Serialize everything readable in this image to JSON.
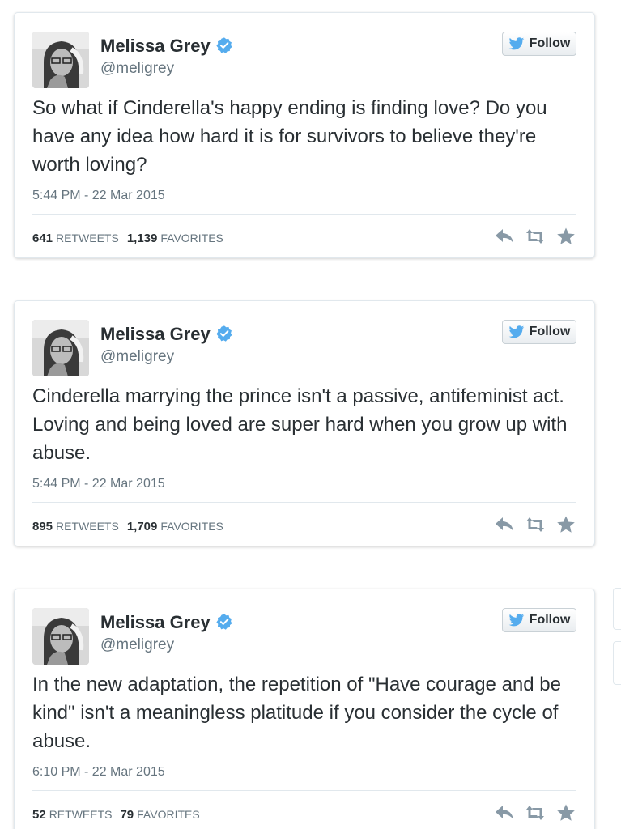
{
  "tweets": [
    {
      "name": "Melissa Grey",
      "handle": "@meligrey",
      "follow_label": "Follow",
      "text": "So what if Cinderella's happy ending is finding love? Do you have any idea how hard it is for survivors to believe they're worth loving?",
      "timestamp": "5:44 PM - 22 Mar 2015",
      "retweets": "641",
      "retweets_label": "RETWEETS",
      "favorites": "1,139",
      "favorites_label": "FAVORITES"
    },
    {
      "name": "Melissa Grey",
      "handle": "@meligrey",
      "follow_label": "Follow",
      "text": "Cinderella marrying the prince isn't a passive, antifeminist act. Loving and being loved are super hard when you grow up with abuse.",
      "timestamp": "5:44 PM - 22 Mar 2015",
      "retweets": "895",
      "retweets_label": "RETWEETS",
      "favorites": "1,709",
      "favorites_label": "FAVORITES"
    },
    {
      "name": "Melissa Grey",
      "handle": "@meligrey",
      "follow_label": "Follow",
      "text": "In the new adaptation, the repetition of \"Have courage and be kind\" isn't a meaningless platitude if you consider the cycle of abuse.",
      "timestamp": "6:10 PM - 22 Mar 2015",
      "retweets": "52",
      "retweets_label": "RETWEETS",
      "favorites": "79",
      "favorites_label": "FAVORITES"
    }
  ],
  "icons": {
    "verified": "verified-badge-icon",
    "follow": "twitter-bird-icon",
    "reply": "reply-icon",
    "retweet": "retweet-icon",
    "favorite": "star-icon"
  },
  "colors": {
    "verified_blue": "#55acee",
    "bird_blue": "#55acee",
    "text": "#292f33",
    "muted": "#66757f",
    "action_gray": "#8899a6",
    "border": "#e1e8ed"
  }
}
